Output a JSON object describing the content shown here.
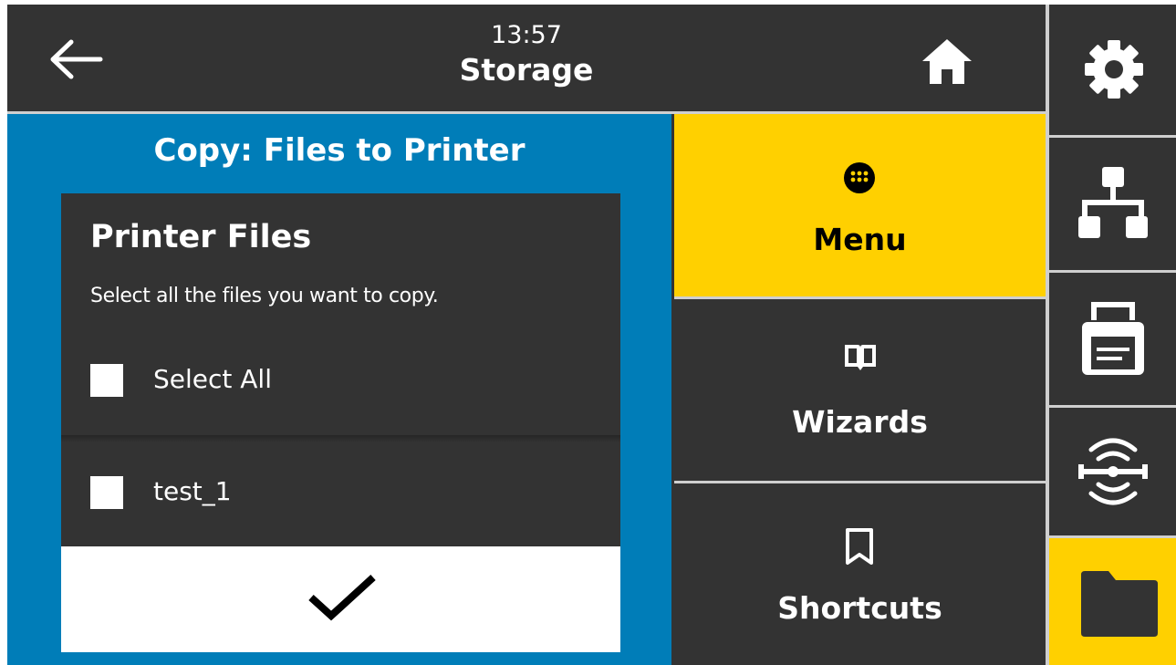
{
  "header": {
    "time": "13:57",
    "title": "Storage"
  },
  "dialog": {
    "title": "Copy: Files to Printer",
    "card_title": "Printer Files",
    "description": "Select all the files you want to copy.",
    "rows": [
      {
        "label": "Select All",
        "checked": false
      },
      {
        "label": "test_1",
        "checked": false
      }
    ]
  },
  "nav": {
    "menu_label": "Menu",
    "wizards_label": "Wizards",
    "shortcuts_label": "Shortcuts",
    "active": "Menu"
  },
  "sidebar": {
    "icons": [
      "gear-icon",
      "network-icon",
      "printer-icon",
      "rfid-icon",
      "folder-icon"
    ],
    "active": "folder-icon"
  },
  "colors": {
    "accent_yellow": "#ffd000",
    "panel_blue": "#007db8",
    "background_dark": "#333333"
  }
}
